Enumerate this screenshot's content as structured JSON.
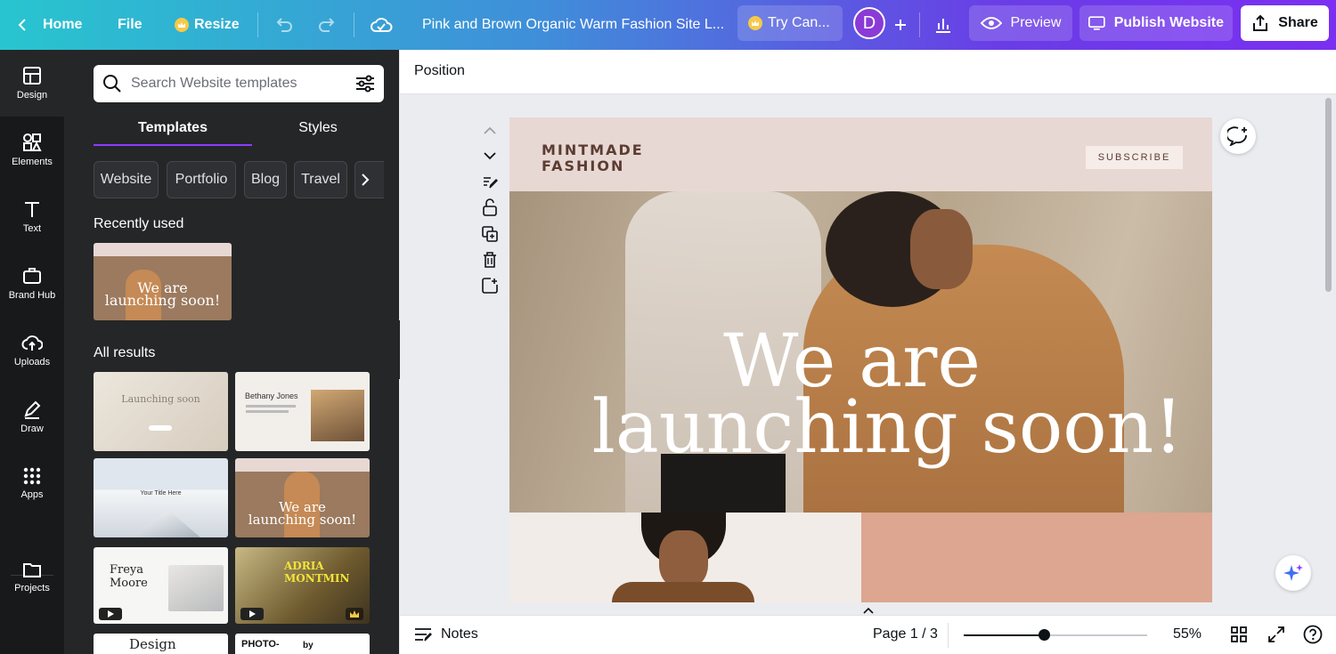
{
  "topbar": {
    "home_label": "Home",
    "file_label": "File",
    "resize_label": "Resize",
    "doc_title": "Pink and Brown Organic Warm Fashion Site L...",
    "try_label": "Try Can...",
    "avatar_initial": "D",
    "preview_label": "Preview",
    "publish_label": "Publish Website",
    "share_label": "Share"
  },
  "rail": {
    "items": [
      {
        "label": "Design"
      },
      {
        "label": "Elements"
      },
      {
        "label": "Text"
      },
      {
        "label": "Brand Hub"
      },
      {
        "label": "Uploads"
      },
      {
        "label": "Draw"
      },
      {
        "label": "Apps"
      },
      {
        "label": "Projects"
      }
    ]
  },
  "panel": {
    "search_placeholder": "Search Website templates",
    "tabs": [
      "Templates",
      "Styles"
    ],
    "chips": [
      "Website",
      "Portfolio",
      "Blog",
      "Travel"
    ],
    "recently_used": "Recently used",
    "all_results": "All results",
    "thumb_texts": {
      "recent_line1": "We are",
      "recent_line2": "launching soon!",
      "t1": "Launching soon",
      "t2_name": "Bethany Jones",
      "t3": "Your Title Here",
      "t4_line1": "We are",
      "t4_line2": "launching soon!",
      "t5_line1": "Freya",
      "t5_line2": "Moore",
      "t6_line1": "ADRIA",
      "t6_line2": "MONTMIN",
      "t7": "Design",
      "t8_line1": "PHOTO-",
      "t8_line2": "by"
    }
  },
  "ctx": {
    "position_label": "Position"
  },
  "design": {
    "brand_line1": "MINTMADE",
    "brand_line2": "FASHION",
    "subscribe_label": "SUBSCRIBE",
    "headline_line1": "We are",
    "headline_line2": "launching soon!"
  },
  "bottom": {
    "notes_label": "Notes",
    "page_label": "Page 1 / 3",
    "zoom_label": "55%",
    "zoom_value": 0.55
  },
  "colors": {
    "accent": "#8b3dff",
    "header_pink": "#e8d8d4",
    "terracotta": "#dca690"
  }
}
